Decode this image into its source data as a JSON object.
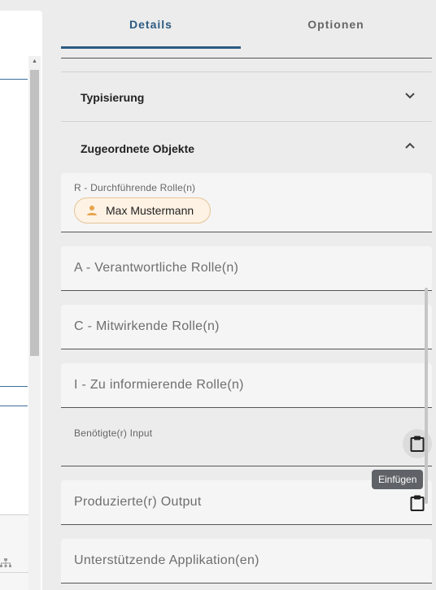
{
  "tabs": {
    "details_label": "Details",
    "options_label": "Optionen"
  },
  "sections": {
    "typisierung_title": "Typisierung",
    "zugeordnete_title": "Zugeordnete Objekte"
  },
  "fields": {
    "r_label": "R - Durchführende Rolle(n)",
    "r_chip": "Max Mustermann",
    "a_placeholder": "A - Verantwortliche Rolle(n)",
    "c_placeholder": "C - Mitwirkende Rolle(n)",
    "i_placeholder": "I - Zu informierende Rolle(n)",
    "input_label": "Benötigte(r) Input",
    "output_placeholder": "Produzierte(r) Output",
    "app_placeholder": "Unterstützende Applikation(en)"
  },
  "tooltip": "Einfügen",
  "icons": {
    "expand": "chevron-down-icon",
    "collapse": "chevron-up-icon",
    "paste": "clipboard-icon",
    "person": "person-icon",
    "cursor": "hand-pointer-icon"
  },
  "colors": {
    "accent": "#2c5a82",
    "chip_bg": "#fdf2e4",
    "chip_border": "#e6c497",
    "person_icon": "#e8a44c"
  }
}
